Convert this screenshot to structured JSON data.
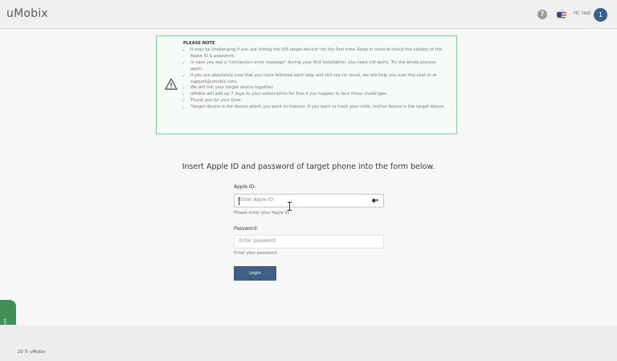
{
  "app": {
    "brand": "uMobix"
  },
  "header": {
    "greeting": "Hi, test",
    "avatar_initial": "1",
    "help_icon": "question-circle-icon",
    "flag_icon": "us-flag-icon"
  },
  "note": {
    "title": "PLEASE NOTE",
    "items": [
      "It may be challenging if you are linking the iOS target device* for the first time. Keep in mind to check the validity of the Apple ID & password.",
      "In case you see a \"connection error message\" during your first installation, you need not worry. Try the whole process again.",
      "If you are absolutely sure that you have followed each step and still see no result, we will help you over the chat or at support@umobix.com.",
      "We will link your target device together.",
      "uMobix will add up 7 days to your subscription for free if you happen to face these challenges.",
      "Thank you for your time.",
      "*target device is the device which you want to monitor. If you want to track your child, his/her device is the target device."
    ]
  },
  "form": {
    "heading": "Insert Apple ID and password of target phone into the form below.",
    "apple_id_label": "Apple ID:",
    "apple_id_placeholder": "Enter Apple ID",
    "apple_id_help": "Please enter your Apple ID",
    "password_label": "Password:",
    "password_placeholder": "Enter password",
    "password_help": "Enter your password.",
    "login_label": "Login"
  },
  "side_tab": {
    "label": "Contact support"
  },
  "footer": {
    "text": "20 © uMobix"
  },
  "colors": {
    "accent": "#3e5f86",
    "note_border": "#8ec49a",
    "side_tab": "#3f8f57"
  }
}
